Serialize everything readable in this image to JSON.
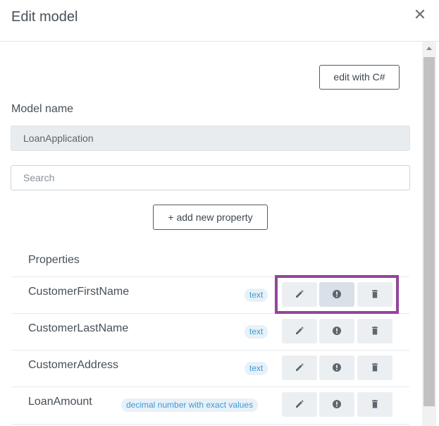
{
  "dialog": {
    "title": "Edit model",
    "close_glyph": "✕"
  },
  "toolbar": {
    "edit_csharp_label": "edit with C#"
  },
  "model_name": {
    "label": "Model name",
    "value": "LoanApplication"
  },
  "search": {
    "placeholder": "Search",
    "value": ""
  },
  "add_property_label": "+ add new property",
  "properties": {
    "heading": "Properties",
    "rows": [
      {
        "name": "CustomerFirstName",
        "type": "text"
      },
      {
        "name": "CustomerLastName",
        "type": "text"
      },
      {
        "name": "CustomerAddress",
        "type": "text"
      },
      {
        "name": "LoanAmount",
        "type": "decimal number with exact values"
      }
    ]
  },
  "icons": {
    "edit": "pencil-icon",
    "validation": "exclamation-circle-icon",
    "delete": "trash-icon",
    "close": "close-icon"
  },
  "colors": {
    "highlight": "#93469b",
    "badge_text": "#3d9ad6",
    "badge_bg": "#e8f1f8"
  }
}
